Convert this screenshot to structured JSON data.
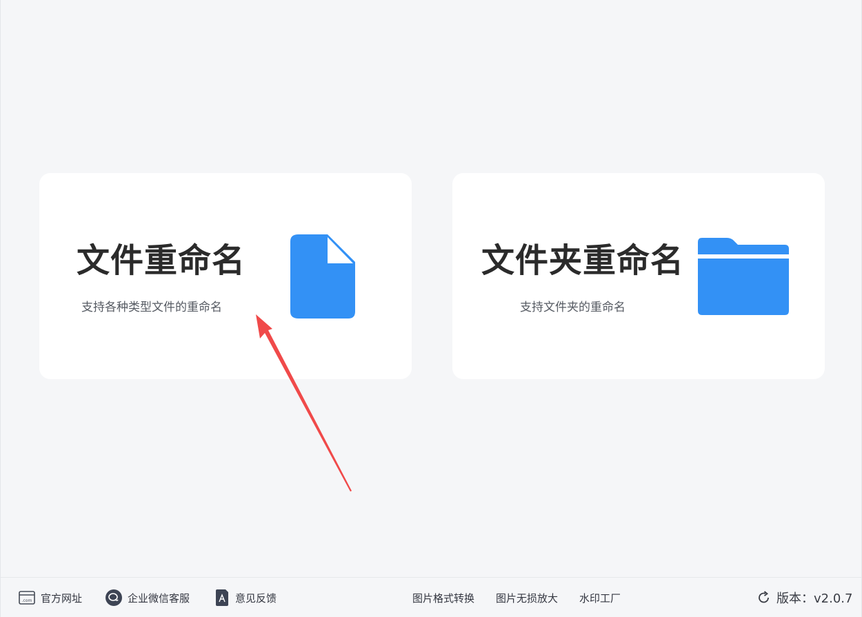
{
  "cards": [
    {
      "title": "文件重命名",
      "description": "支持各种类型文件的重命名",
      "icon": "file-icon",
      "icon_color": "#3391f5"
    },
    {
      "title": "文件夹重命名",
      "description": "支持文件夹的重命名",
      "icon": "folder-icon",
      "icon_color": "#3391f5"
    }
  ],
  "annotation": {
    "icon": "red-arrow-pointer",
    "color": "#f04a4a"
  },
  "footer": {
    "left_links": [
      {
        "label": "官方网址",
        "icon": "website-icon"
      },
      {
        "label": "企业微信客服",
        "icon": "wechat-service-icon"
      },
      {
        "label": "意见反馈",
        "icon": "feedback-icon"
      }
    ],
    "center_links": [
      {
        "label": "图片格式转换"
      },
      {
        "label": "图片无损放大"
      },
      {
        "label": "水印工厂"
      }
    ],
    "version": {
      "label": "版本：v2.0.7",
      "icon": "refresh-icon"
    }
  },
  "colors": {
    "background": "#f5f6f8",
    "card": "#ffffff",
    "accent": "#3391f5",
    "title_text": "#2b2b2b",
    "body_text": "#555a62"
  }
}
